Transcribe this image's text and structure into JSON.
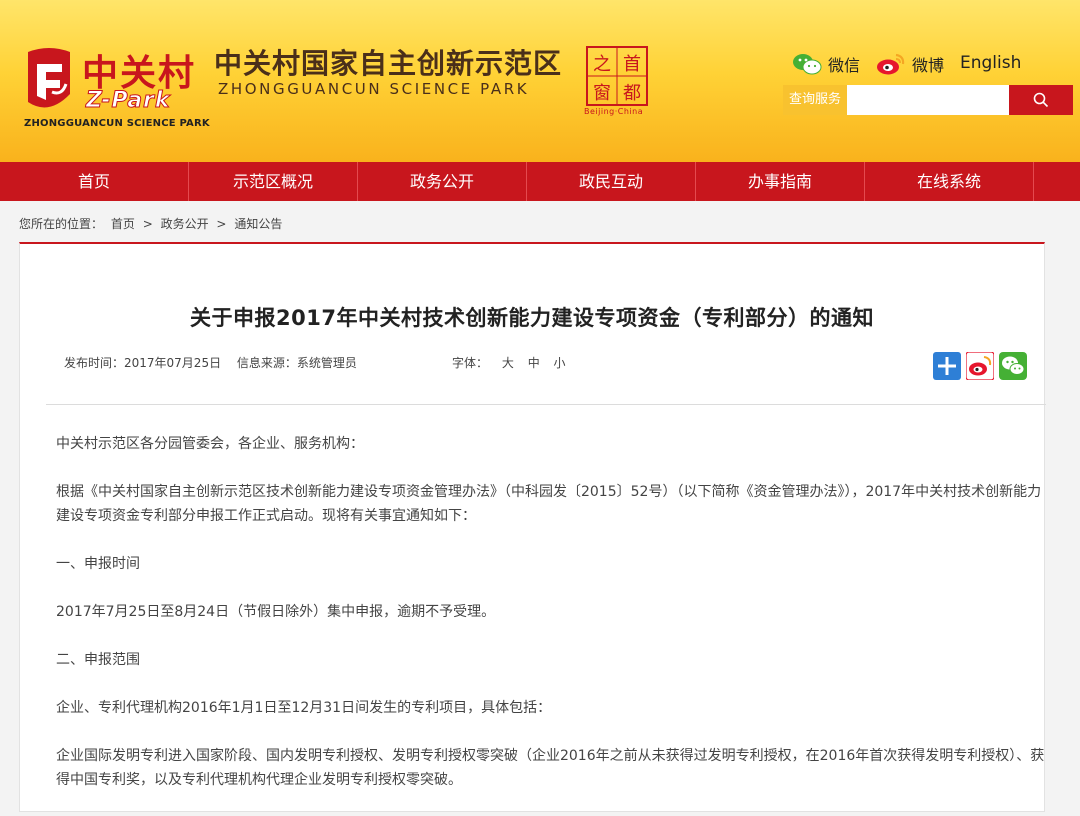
{
  "header": {
    "logo_cn": "中关村",
    "logo_zpark": "Z-Park",
    "logo_en": "ZHONGGUANCUN SCIENCE PARK",
    "site_title_cn": "中关村国家自主创新示范区",
    "site_title_en": "ZHONGGUANCUN SCIENCE PARK",
    "seal_chars": [
      "首",
      "都",
      "之",
      "窗"
    ],
    "seal_sub": "Beijing·China",
    "social": {
      "wechat_label": "微信",
      "weibo_label": "微博",
      "english_label": "English"
    },
    "search": {
      "label": "查询服务",
      "placeholder": "",
      "icon": "search-icon"
    }
  },
  "nav": {
    "items": [
      "首页",
      "示范区概况",
      "政务公开",
      "政民互动",
      "办事指南",
      "在线系统"
    ]
  },
  "breadcrumb": {
    "prefix": "您所在的位置：",
    "items": [
      "首页",
      "政务公开",
      "通知公告"
    ],
    "separator": ">"
  },
  "article": {
    "title": "关于申报2017年中关村技术创新能力建设专项资金（专利部分）的通知",
    "publish_time": "发布时间：2017年07月25日",
    "source": "信息来源：系统管理员",
    "font_label": "字体：",
    "font_sizes": [
      "大",
      "中",
      "小"
    ],
    "share_icons": [
      "plus-share-icon",
      "weibo-share-icon",
      "wechat-share-icon"
    ],
    "paragraphs": [
      "中关村示范区各分园管委会，各企业、服务机构：",
      "根据《中关村国家自主创新示范区技术创新能力建设专项资金管理办法》（中科园发〔2015〕52号）（以下简称《资金管理办法》），2017年中关村技术创新能力建设专项资金专利部分申报工作正式启动。现将有关事宜通知如下：",
      "一、申报时间",
      "2017年7月25日至8月24日（节假日除外）集中申报，逾期不予受理。",
      "二、申报范围",
      "企业、专利代理机构2016年1月1日至12月31日间发生的专利项目，具体包括：",
      "企业国际发明专利进入国家阶段、国内发明专利授权、发明专利授权零突破（企业2016年之前从未获得过发明专利授权，在2016年首次获得发明专利授权）、获得中国专利奖，以及专利代理机构代理企业发明专利授权零突破。"
    ]
  },
  "colors": {
    "brand_red": "#c8161d",
    "header_yellow": "#ffd236",
    "search_label_bg": "#f8c22f"
  }
}
